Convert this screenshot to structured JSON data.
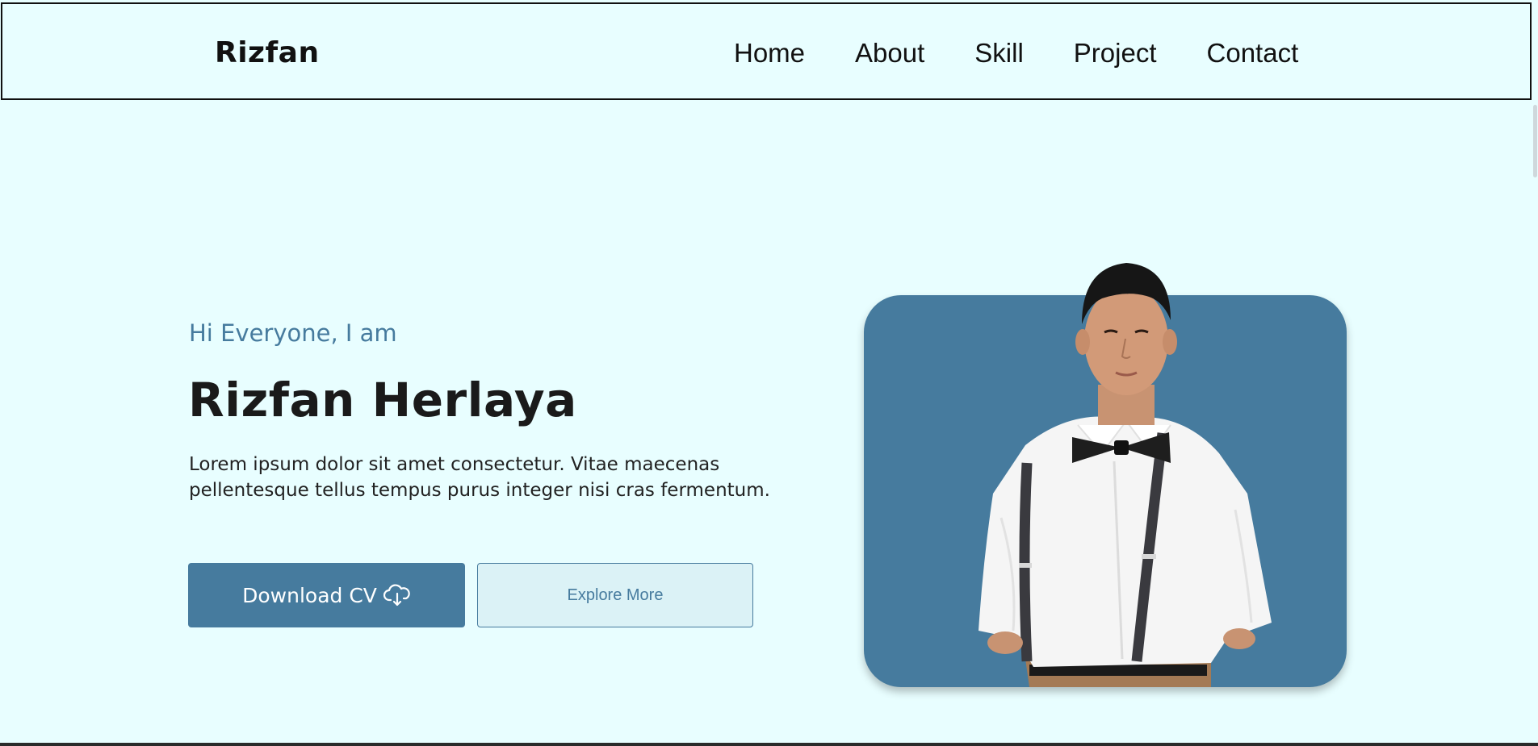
{
  "header": {
    "logo": "Rizfan",
    "nav": [
      "Home",
      "About",
      "Skill",
      "Project",
      "Contact"
    ]
  },
  "hero": {
    "greeting": "Hi Everyone, I am",
    "name": "Rizfan Herlaya",
    "description": "Lorem ipsum dolor sit amet consectetur. Vitae maecenas pellentesque tellus tempus purus integer nisi cras fermentum.",
    "primary_button": "Download CV",
    "primary_button_icon": "cloud-download-icon",
    "secondary_button": "Explore More"
  },
  "colors": {
    "background": "#e8feff",
    "accent": "#467b9e",
    "secondary_button_bg": "#dbf2f6",
    "text_dark": "#1a1a1a"
  }
}
